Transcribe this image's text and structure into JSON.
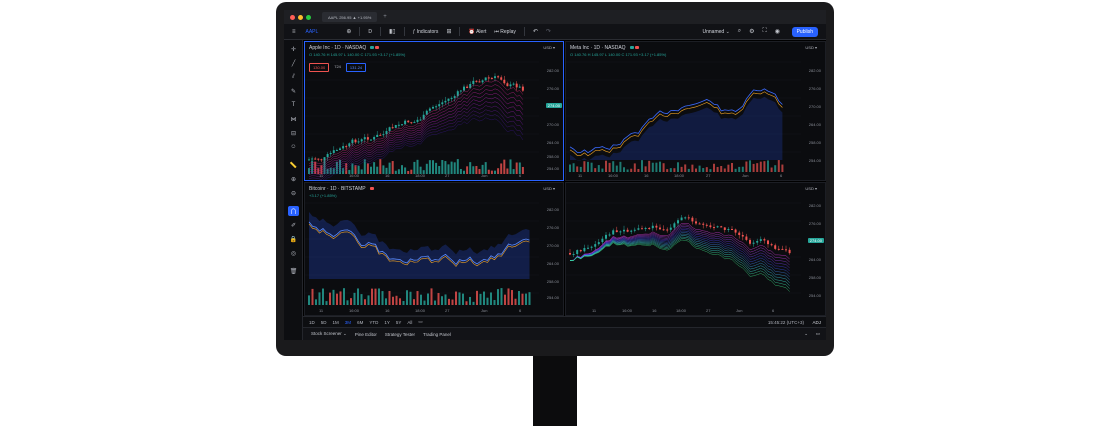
{
  "tabbar": {
    "tab_label": "AAPL 256.95 ▲ +1.95%",
    "plus": "+"
  },
  "toolbar": {
    "symbol": "AAPL",
    "interval": "D",
    "indicators": "Indicators",
    "alert": "Alert",
    "replay": "Replay",
    "layout_name": "Unnamed",
    "publish": "Publish"
  },
  "panes": [
    {
      "title": "Apple Inc · 1D · NASDAQ",
      "ohlc": "O 140.76 H 145.97 L 140.00 C 171.93 +3.17 (+1.85%)",
      "currency": "USD ▾",
      "order": {
        "sell": "130.00",
        "spread": "724",
        "buy": "131.24"
      },
      "y_ticks": [
        "282.00",
        "276.00",
        "270.00",
        "264.00",
        "258.00",
        "254.00"
      ],
      "last_price": "274.00",
      "x_ticks": [
        "11",
        "16:00",
        "16",
        "18:00",
        "27",
        "Jun",
        "6"
      ]
    },
    {
      "title": "Meta Inc · 1D · NASDAQ",
      "ohlc": "O 140.76 H 145.97 L 140.00 C 171.93 +3.17 (+1.85%)",
      "currency": "USD ▾",
      "y_ticks": [
        "282.00",
        "276.00",
        "270.00",
        "264.00",
        "258.00",
        "254.00"
      ],
      "x_ticks": [
        "11",
        "16:00",
        "16",
        "18:00",
        "27",
        "Jun",
        "6"
      ]
    },
    {
      "title": "Bitcoinr · 1D · BITSTAMP",
      "ohlc": "+3.17 (+1.85%)",
      "currency": "USD ▾",
      "y_ticks": [
        "282.00",
        "276.00",
        "270.00",
        "264.00",
        "258.00",
        "254.00"
      ],
      "x_ticks": [
        "11",
        "16:00",
        "16",
        "18:00",
        "27",
        "Jun",
        "6"
      ]
    },
    {
      "title": "",
      "ohlc": "",
      "currency": "USD ▾",
      "y_ticks": [
        "282.00",
        "276.00",
        "270.00",
        "264.00",
        "258.00",
        "254.00"
      ],
      "last_price": "274.00",
      "x_ticks": [
        "11",
        "16:00",
        "16",
        "18:00",
        "27",
        "Jun",
        "6"
      ]
    }
  ],
  "timeframes": [
    "1D",
    "5D",
    "1M",
    "3M",
    "6M",
    "YTD",
    "1Y",
    "5Y",
    "All"
  ],
  "clock": "15:45:22 (UTC+3)",
  "adj": "ADJ",
  "panelbar": {
    "screener": "Stock Screener",
    "pine": "Pine Editor",
    "tester": "Strategy Tester",
    "trading": "Trading Panel"
  },
  "colors": {
    "up": "#26a69a",
    "down": "#ef5350",
    "accent": "#2962ff",
    "ma": "#f5a623"
  }
}
